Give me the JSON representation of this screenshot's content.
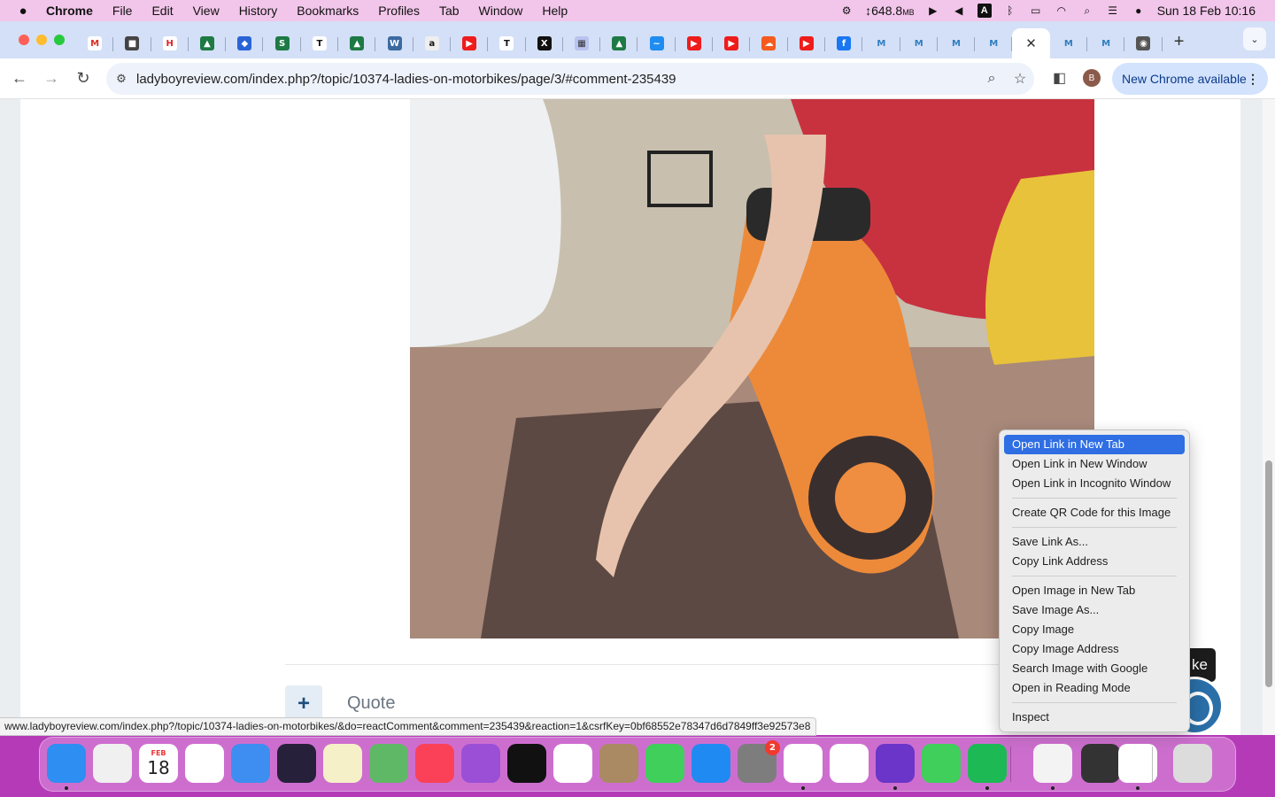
{
  "menubar": {
    "app_name": "Chrome",
    "items": [
      "File",
      "Edit",
      "View",
      "History",
      "Bookmarks",
      "Profiles",
      "Tab",
      "Window",
      "Help"
    ],
    "memory": "↕648.8",
    "memory_unit": "MB",
    "datetime": "Sun 18 Feb  10:16"
  },
  "tabs": {
    "favicons": [
      "gmail-icon",
      "cube-icon",
      "h-icon",
      "jetpack-icon",
      "blue-diamond-icon",
      "globe-icon",
      "nyt-icon",
      "jetpack-icon",
      "wordpress-icon",
      "amazon-icon",
      "youtube-icon",
      "nyt-icon",
      "x-icon",
      "grid-icon",
      "jetpack-icon",
      "messenger-icon",
      "youtube-icon",
      "youtube-icon",
      "soundcloud-icon",
      "youtube-icon",
      "facebook-icon",
      "site-m-icon",
      "site-m-icon",
      "site-m-icon",
      "site-m-icon"
    ],
    "active_close": "✕",
    "after_active": [
      "site-m-icon",
      "site-m-icon",
      "chrome-icon"
    ],
    "new_tab": "+"
  },
  "toolbar": {
    "url": "ladyboyreview.com/index.php?/topic/10374-ladies-on-motorbikes/page/3/#comment-235439",
    "profile_initial": "B",
    "update_label": "New Chrome available"
  },
  "page": {
    "quote_label": "Quote",
    "plus_label": "+",
    "like_tooltip": "ke"
  },
  "statusbar": {
    "hover_url": "www.ladyboyreview.com/index.php?/topic/10374-ladies-on-motorbikes/&do=reactComment&comment=235439&reaction=1&csrfKey=0bf68552e78347d6d7849ff3e92573e8"
  },
  "context_menu": {
    "groups": [
      [
        "Open Link in New Tab",
        "Open Link in New Window",
        "Open Link in Incognito Window"
      ],
      [
        "Create QR Code for this Image"
      ],
      [
        "Save Link As...",
        "Copy Link Address"
      ],
      [
        "Open Image in New Tab",
        "Save Image As...",
        "Copy Image",
        "Copy Image Address",
        "Search Image with Google",
        "Open in Reading Mode"
      ],
      [
        "Inspect"
      ]
    ]
  },
  "dock": {
    "calendar_month": "FEB",
    "calendar_day": "18",
    "settings_badge": "2",
    "apps": [
      "finder",
      "launchpad",
      "calendar",
      "opera",
      "mail",
      "siri",
      "notes",
      "maps",
      "music",
      "podcasts",
      "apple-tv",
      "photos",
      "contacts",
      "messages",
      "app-store",
      "system-settings",
      "chrome",
      "reminders",
      "firefox",
      "facetime",
      "spotify",
      "textedit",
      "screenshot",
      "recorder",
      "trash"
    ]
  },
  "colors": {
    "menubar_bg": "#f2c6ea",
    "tabstrip_bg": "#d4e0f7",
    "highlight": "#2f6ee3",
    "update_button": "#d3e3fd"
  }
}
